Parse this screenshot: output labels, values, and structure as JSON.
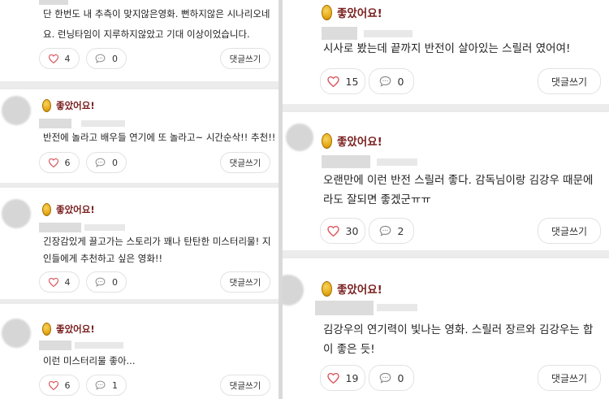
{
  "badge_label": "좋았어요!",
  "reply_label": "댓글쓰기",
  "colors": {
    "badge_text": "#7a1f1f",
    "heart": "#d9535a",
    "coin": "#e3a410"
  },
  "icons": {
    "like": "heart-icon",
    "comment": "speech-bubble-icon",
    "badge": "gold-coin-icon"
  },
  "left_reviews": [
    {
      "lines": [
        "단 한번도 내 추측이 맞지않은영화. 뻔하지않은 시나리오네",
        "요. 런닝타임이 지루하지않았고 기대 이상이었습니다."
      ],
      "likes": "4",
      "comments": "0"
    },
    {
      "lines": [
        "반전에 놀라고 배우들 연기에 또 놀라고~ 시간순삭!! 추천!!"
      ],
      "likes": "6",
      "comments": "0"
    },
    {
      "lines": [
        "긴장감있게 끌고가는 스토리가 꽤나 탄탄한 미스터리물! 지",
        "인들에게 추천하고 싶은 영화!!"
      ],
      "likes": "4",
      "comments": "0"
    },
    {
      "lines": [
        "이런 미스터리물 좋아..."
      ],
      "likes": "6",
      "comments": "1"
    }
  ],
  "right_reviews": [
    {
      "lines": [
        "시사로 봤는데 끝까지 반전이 살아있는 스릴러 였어여!"
      ],
      "likes": "15",
      "comments": "0"
    },
    {
      "lines": [
        "오랜만에 이런 반전 스릴러 좋다. 감독님이랑 김강우 때문에",
        "라도 잘되면 좋겠군ㅠㅠ"
      ],
      "likes": "30",
      "comments": "2"
    },
    {
      "lines": [
        "김강우의 연기력이 빛나는 영화. 스릴러 장르와 김강우는 합",
        "이 좋은 듯!"
      ],
      "likes": "19",
      "comments": "0"
    }
  ]
}
